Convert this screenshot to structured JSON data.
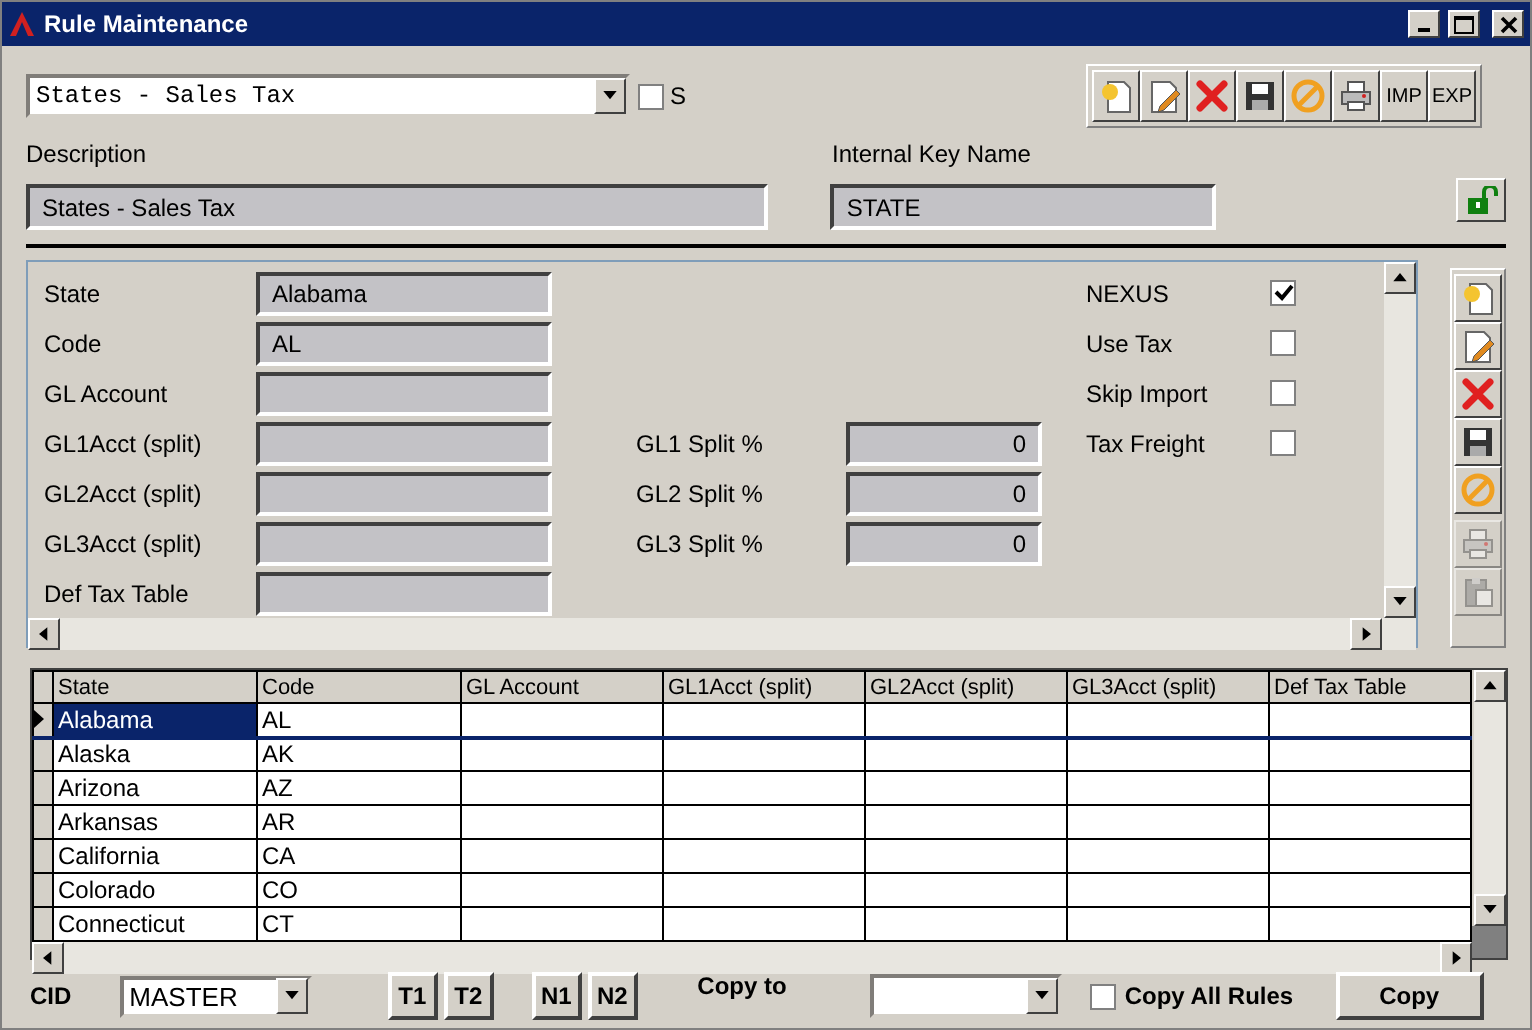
{
  "window": {
    "title": "Rule Maintenance"
  },
  "rule_select": {
    "value": "States - Sales Tax"
  },
  "s_checkbox": {
    "label": "S",
    "checked": false
  },
  "toolbar": [
    {
      "kind": "new"
    },
    {
      "kind": "edit"
    },
    {
      "kind": "delete"
    },
    {
      "kind": "save"
    },
    {
      "kind": "cancel"
    },
    {
      "kind": "print"
    },
    {
      "kind": "text",
      "label": "IMP"
    },
    {
      "kind": "text",
      "label": "EXP"
    }
  ],
  "description": {
    "label": "Description",
    "value": "States - Sales Tax"
  },
  "internal_key": {
    "label": "Internal Key Name",
    "value": "STATE"
  },
  "detail": {
    "fields": [
      {
        "label": "State",
        "value": "Alabama"
      },
      {
        "label": "Code",
        "value": "AL"
      },
      {
        "label": "GL Account"
      },
      {
        "label": "GL1Acct (split)"
      },
      {
        "label": "GL2Acct (split)"
      },
      {
        "label": "GL3Acct (split)"
      },
      {
        "label": "Def Tax Table"
      }
    ],
    "splits": [
      {
        "label": "GL1 Split %",
        "value": "0"
      },
      {
        "label": "GL2 Split %",
        "value": "0"
      },
      {
        "label": "GL3 Split %",
        "value": "0"
      }
    ],
    "flags": [
      {
        "label": "NEXUS",
        "checked": true
      },
      {
        "label": "Use Tax",
        "checked": false
      },
      {
        "label": "Skip Import",
        "checked": false
      },
      {
        "label": "Tax Freight",
        "checked": false
      }
    ]
  },
  "side_toolbar": [
    {
      "kind": "new",
      "disabled": false
    },
    {
      "kind": "edit",
      "disabled": false
    },
    {
      "kind": "delete",
      "disabled": false
    },
    {
      "kind": "save",
      "disabled": false
    },
    {
      "kind": "cancel",
      "disabled": false
    },
    {
      "kind": "print",
      "disabled": true
    },
    {
      "kind": "paste",
      "disabled": true
    }
  ],
  "grid": {
    "columns": [
      "State",
      "Code",
      "GL Account",
      "GL1Acct (split)",
      "GL2Acct (split)",
      "GL3Acct (split)",
      "Def Tax Table"
    ],
    "rows": [
      {
        "cells": [
          "Alabama",
          "AL"
        ],
        "selected": true
      },
      {
        "cells": [
          "Alaska",
          "AK"
        ],
        "selected": false
      },
      {
        "cells": [
          "Arizona",
          "AZ"
        ],
        "selected": false
      },
      {
        "cells": [
          "Arkansas",
          "AR"
        ],
        "selected": false
      },
      {
        "cells": [
          "California",
          "CA"
        ],
        "selected": false
      },
      {
        "cells": [
          "Colorado",
          "CO"
        ],
        "selected": false
      },
      {
        "cells": [
          "Connecticut",
          "CT"
        ],
        "selected": false
      }
    ]
  },
  "bottom": {
    "cid": {
      "label": "CID",
      "value": "MASTER"
    },
    "buttons": [
      "T1",
      "T2",
      "N1",
      "N2"
    ],
    "copy_to": {
      "label": "Copy to"
    },
    "copy_all": {
      "label": "Copy All Rules",
      "checked": false
    },
    "copy_button": "Copy"
  }
}
